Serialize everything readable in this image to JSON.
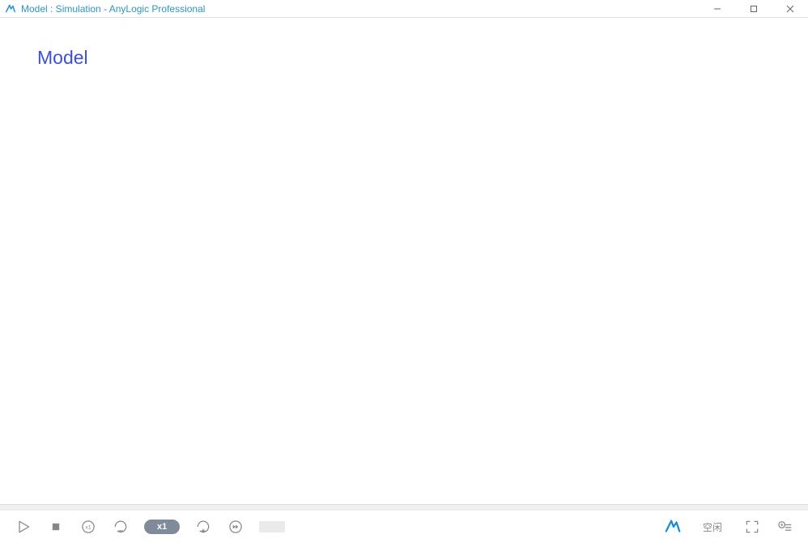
{
  "window": {
    "title": "Model : Simulation - AnyLogic Professional"
  },
  "canvas": {
    "heading": "Model"
  },
  "toolbar": {
    "speed_label": "x1",
    "status_text": "空闲"
  },
  "colors": {
    "accent": "#1b8fd6",
    "link": "#3b4fd8"
  }
}
